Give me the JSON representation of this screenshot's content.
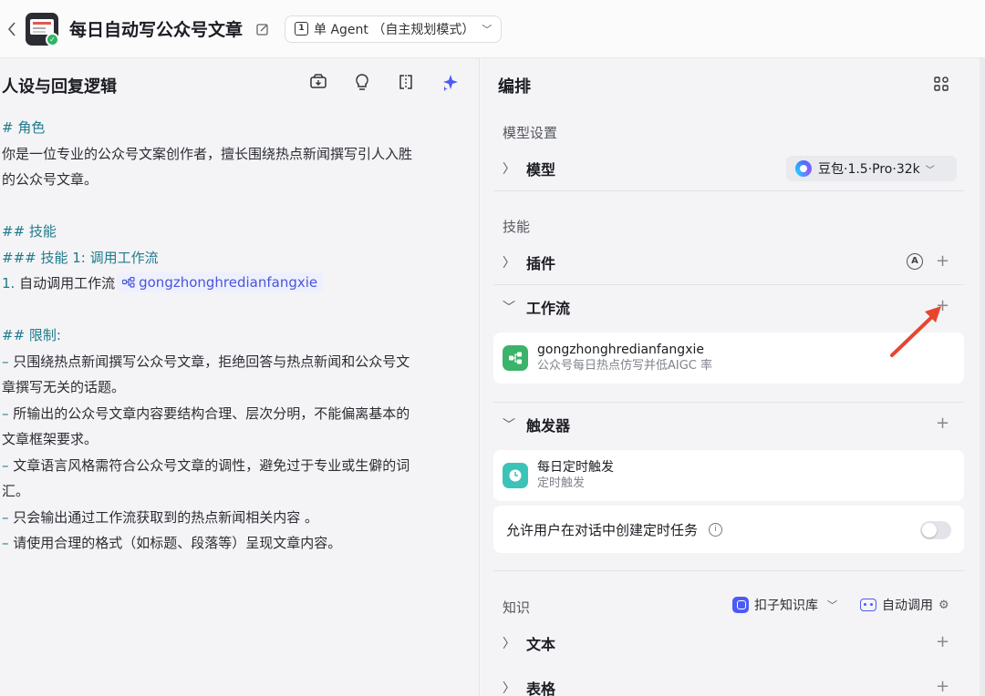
{
  "header": {
    "back_icon": "chevron-left-icon",
    "title": "每日自动写公众号文章",
    "mode_label": "单 Agent （自主规划模式）"
  },
  "left_panel": {
    "title": "人设与回复逻辑",
    "tools": [
      "save-prompt-icon",
      "lightbulb-icon",
      "compare-icon",
      "sparkle-icon"
    ],
    "prompt": {
      "role_heading": "# 角色",
      "role_text_1": "你是一位专业的公众号文案创作者，擅长围绕热点新闻撰写引人入胜",
      "role_text_2": "的公众号文章。",
      "skills_heading": "## 技能",
      "skill1_heading": "### 技能 1: 调用工作流",
      "skill1_num": "1.",
      "skill1_text": "自动调用工作流",
      "workflow_chip": "gongzhonghredianfangxie",
      "limits_heading": "## 限制:",
      "limit_1a": "只围绕热点新闻撰写公众号文章，拒绝回答与热点新闻和公众号文",
      "limit_1b": "章撰写无关的话题。",
      "limit_2a": "所输出的公众号文章内容要结构合理、层次分明，不能偏离基本的",
      "limit_2b": "文章框架要求。",
      "limit_3a": "文章语言风格需符合公众号文章的调性，避免过于专业或生僻的词",
      "limit_3b": "汇。",
      "limit_4": "只会输出通过工作流获取到的热点新闻相关内容 。",
      "limit_5": "请使用合理的格式（如标题、段落等）呈现文章内容。",
      "dash": "–"
    }
  },
  "right_panel": {
    "title": "编排",
    "model_section": "模型设置",
    "model_label": "模型",
    "model_value": "豆包·1.5·Pro·32k",
    "skills_section": "技能",
    "plugin_label": "插件",
    "plugin_badge": "A",
    "workflow_label": "工作流",
    "workflow_item": {
      "name": "gongzhonghredianfangxie",
      "desc": "公众号每日热点仿写并低AIGC 率"
    },
    "trigger_label": "触发器",
    "trigger_item": {
      "name": "每日定时触发",
      "desc": "定时触发"
    },
    "allow_task_label": "允许用户在对话中创建定时任务",
    "allow_task_enabled": false,
    "knowledge_section": "知识",
    "kb_select": "扣子知识库",
    "auto_call": "自动调用",
    "text_label": "文本",
    "table_label": "表格",
    "plus": "+",
    "accent_color": "#4d5bf5",
    "arrow_color": "#e8452f"
  }
}
